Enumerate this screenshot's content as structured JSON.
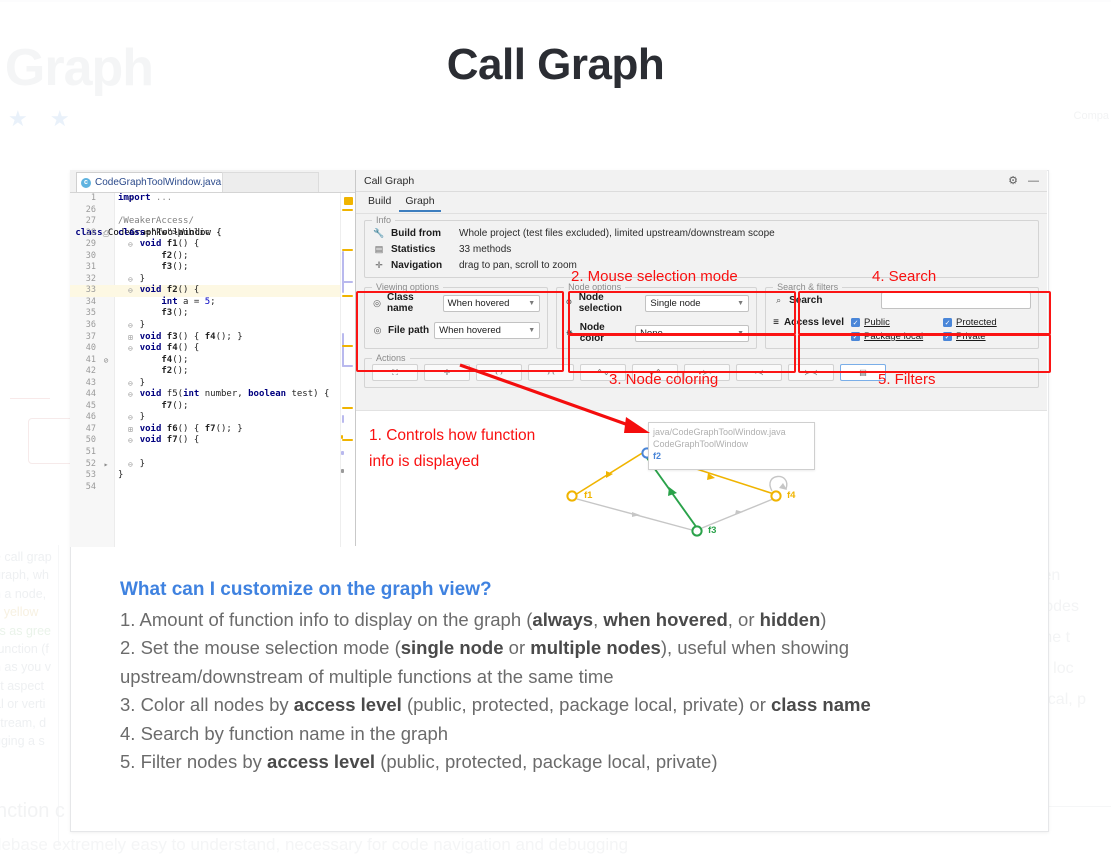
{
  "background": {
    "ghost_title": "l Graph",
    "stars": "★ ★",
    "right_top": "Compa",
    "left_lines": [
      "e call grap",
      " graph, wh",
      "n a node,",
      "s yellow",
      "lls as gree",
      " function (f",
      "h as you v",
      "st aspect",
      "al or verti",
      "stream, d",
      "gging a s"
    ],
    "left_bottom": "nction c",
    "left_bottom2": "debase extremely easy to understand, necessary for code navigation and debugging",
    "right_lines": [
      "when",
      "e nodes",
      " same t",
      "age loc",
      "",
      "e local, p"
    ],
    "ghost_label": "g"
  },
  "headline": "Call Graph",
  "editor": {
    "tab_label": "CodeGraphToolWindow.java",
    "tab_icon": "c",
    "close_icon": "×",
    "lines": [
      {
        "n": "1",
        "fold": "⊟",
        "code": "import ...",
        "cls": "cmt"
      },
      {
        "n": "26",
        "fold": "",
        "code": "",
        "cls": ""
      },
      {
        "n": "27",
        "fold": "",
        "code": "/WeakerAccess/",
        "cls": "an"
      },
      {
        "n": "28",
        "fold": "",
        "code": "public class CodeGraphToolWindow {",
        "cls": "",
        "gm": "⎙"
      },
      {
        "n": "29",
        "fold": "⊖",
        "code": "    void f1() {",
        "cls": ""
      },
      {
        "n": "30",
        "fold": "",
        "code": "        f2();",
        "cls": ""
      },
      {
        "n": "31",
        "fold": "",
        "code": "        f3();",
        "cls": ""
      },
      {
        "n": "32",
        "fold": "⊖",
        "code": "    }",
        "cls": ""
      },
      {
        "n": "33",
        "fold": "⊖",
        "code": "    void f2() {",
        "cls": "",
        "hl": true
      },
      {
        "n": "34",
        "fold": "",
        "code": "        int a = 5;",
        "cls": ""
      },
      {
        "n": "35",
        "fold": "",
        "code": "        f3();",
        "cls": ""
      },
      {
        "n": "36",
        "fold": "⊖",
        "code": "    }",
        "cls": ""
      },
      {
        "n": "37",
        "fold": "⊞",
        "code": "    void f3() { f4(); }",
        "cls": ""
      },
      {
        "n": "40",
        "fold": "⊖",
        "code": "    void f4() {",
        "cls": ""
      },
      {
        "n": "41",
        "fold": "",
        "code": "        f4();",
        "cls": "",
        "gm": "⊘"
      },
      {
        "n": "42",
        "fold": "",
        "code": "        f2();",
        "cls": ""
      },
      {
        "n": "43",
        "fold": "⊖",
        "code": "    }",
        "cls": ""
      },
      {
        "n": "44",
        "fold": "⊖",
        "code": "    void f5(int number, boolean test) {",
        "cls": ""
      },
      {
        "n": "45",
        "fold": "",
        "code": "        f7();",
        "cls": ""
      },
      {
        "n": "46",
        "fold": "⊖",
        "code": "    }",
        "cls": ""
      },
      {
        "n": "47",
        "fold": "⊞",
        "code": "    void f6() { f7(); }",
        "cls": ""
      },
      {
        "n": "50",
        "fold": "⊖",
        "code": "    void f7() {",
        "cls": ""
      },
      {
        "n": "51",
        "fold": "",
        "code": "",
        "cls": ""
      },
      {
        "n": "52",
        "fold": "⊖",
        "code": "    }",
        "cls": "",
        "gm": "▸"
      },
      {
        "n": "53",
        "fold": "",
        "code": "}",
        "cls": ""
      },
      {
        "n": "54",
        "fold": "",
        "code": "",
        "cls": ""
      }
    ]
  },
  "toolwindow": {
    "title": "Call Graph",
    "gear_icon": "⚙",
    "minimize_icon": "—",
    "tabs": [
      {
        "label": "Build",
        "active": false
      },
      {
        "label": "Graph",
        "active": true
      }
    ],
    "info": {
      "legend": "Info",
      "rows": [
        {
          "icon": "wrench-icon",
          "glyph": "🔧",
          "label": "Build from",
          "value": "Whole project (test files excluded), limited upstream/downstream scope"
        },
        {
          "icon": "stats-icon",
          "glyph": "▤",
          "label": "Statistics",
          "value": "33 methods"
        },
        {
          "icon": "move-icon",
          "glyph": "✛",
          "label": "Navigation",
          "value": "drag to pan, scroll to zoom"
        }
      ]
    },
    "viewing_options": {
      "legend": "Viewing options",
      "items": [
        {
          "icon": "eye-icon",
          "glyph": "◎",
          "label": "Class name",
          "value": "When hovered"
        },
        {
          "icon": "eye-icon",
          "glyph": "◎",
          "label": "File path",
          "value": "When hovered"
        }
      ]
    },
    "node_options": {
      "legend": "Node options",
      "items": [
        {
          "icon": "pin-icon",
          "glyph": "⚲",
          "label": "Node selection",
          "value": "Single node"
        },
        {
          "icon": "palette-icon",
          "glyph": "✸",
          "label": "Node color",
          "value": "None"
        }
      ]
    },
    "search_filters": {
      "legend": "Search & filters",
      "search_label": "Search",
      "search_icon": "⌕",
      "search_value": "",
      "filter_icon": "≡",
      "access_label": "Access level",
      "checkboxes": [
        {
          "label": "Public",
          "checked": true
        },
        {
          "label": "Protected",
          "checked": true
        },
        {
          "label": "Package local",
          "checked": true
        },
        {
          "label": "Private",
          "checked": true
        }
      ],
      "check_glyph": "✓"
    },
    "actions": {
      "legend": "Actions",
      "buttons": [
        {
          "name": "fit-to-window-button",
          "glyph": "⛶",
          "selected": false
        },
        {
          "name": "zoom-to-fit-button",
          "glyph": "✛",
          "selected": false
        },
        {
          "name": "expand-horizontal-button",
          "glyph": "‹ ›",
          "selected": false
        },
        {
          "name": "collapse-horizontal-button",
          "glyph": "› ‹",
          "selected": false
        },
        {
          "name": "expand-vertical-button",
          "glyph": "⌃⌄",
          "selected": false
        },
        {
          "name": "collapse-vertical-button",
          "glyph": "⌄⌃",
          "selected": false
        },
        {
          "name": "upstream-button",
          "glyph": "≻•",
          "selected": false
        },
        {
          "name": "downstream-button",
          "glyph": "•≺",
          "selected": false
        },
        {
          "name": "both-directions-button",
          "glyph": "≻≺",
          "selected": false
        },
        {
          "name": "show-source-button",
          "glyph": "▤",
          "selected": true
        }
      ]
    }
  },
  "graph": {
    "tooltip": {
      "path": "java/CodeGraphToolWindow.java",
      "class": "CodeGraphToolWindow",
      "func": "f2"
    },
    "nodes": [
      {
        "id": "f1",
        "label": "f1",
        "color": "#f0b400"
      },
      {
        "id": "f2",
        "label": "f2",
        "color": "#4a86d8"
      },
      {
        "id": "f3",
        "label": "f3",
        "color": "#2aa24a"
      },
      {
        "id": "f4",
        "label": "f4",
        "color": "#f0b400"
      }
    ]
  },
  "annotations": [
    {
      "id": 1,
      "text": "1. Controls how function"
    },
    {
      "id": 1,
      "text": "info is displayed"
    },
    {
      "id": 2,
      "text": "2. Mouse selection mode"
    },
    {
      "id": 3,
      "text": "3. Node coloring"
    },
    {
      "id": 4,
      "text": "4. Search"
    },
    {
      "id": 5,
      "text": "5. Filters"
    }
  ],
  "ann": {
    "a1l1": "1. Controls how function",
    "a1l2": "info is displayed",
    "a2": "2. Mouse selection mode",
    "a3": "3. Node coloring",
    "a4": "4. Search",
    "a5": "5. Filters"
  },
  "body": {
    "heading": "What can I customize on the graph view?",
    "l1a": "1. Amount of function info to display on the graph (",
    "l1b": "always",
    "l1c": ", ",
    "l1d": "when hovered",
    "l1e": ", or ",
    "l1f": "hidden",
    "l1g": ")",
    "l2a": "2. Set the mouse selection mode (",
    "l2b": "single node",
    "l2c": " or ",
    "l2d": "multiple nodes",
    "l2e": "), useful when showing upstream/downstream of multiple functions at the same time",
    "l3a": "3. Color all nodes by ",
    "l3b": "access level",
    "l3c": " (public, protected, package local, private) or ",
    "l3d": "class name",
    "l4": "4. Search by function name in the graph",
    "l5a": "5. Filter nodes by ",
    "l5b": "access level",
    "l5c": " (public, protected, package local, private)"
  },
  "colors": {
    "accent_blue": "#3f82e0",
    "annotation_red": "#f91010",
    "node_yellow": "#f0b400",
    "node_green": "#2aa24a",
    "node_blue": "#4a86d8",
    "checkbox_blue": "#4a86d8"
  }
}
